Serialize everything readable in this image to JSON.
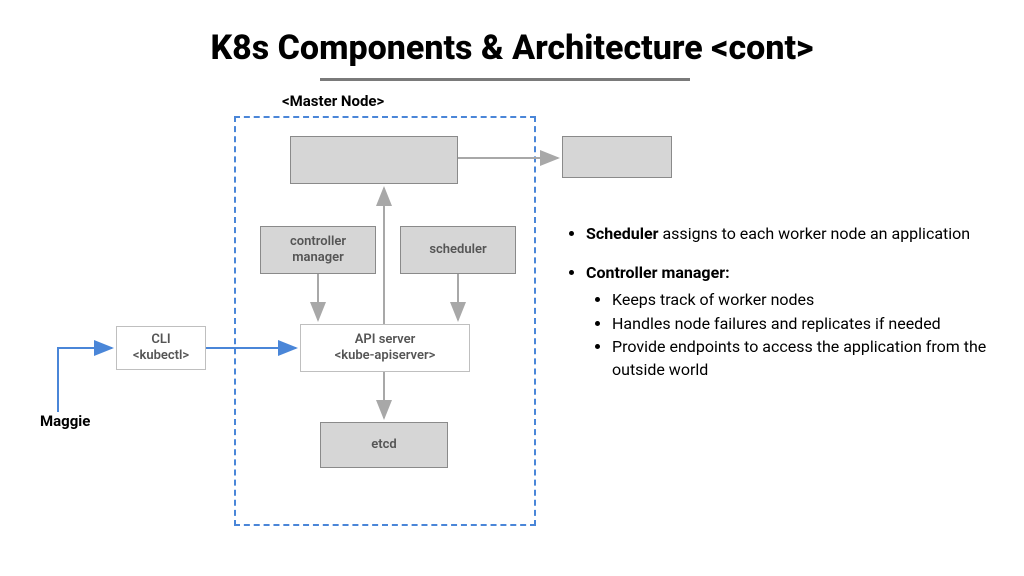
{
  "title": "K8s Components & Architecture <cont>",
  "master_label": "<Master Node>",
  "maggie": "Maggie",
  "boxes": {
    "top_blank": "",
    "right_blank": "",
    "controller_manager": "controller\nmanager",
    "scheduler": "scheduler",
    "api_server": "API server\n<kube-apiserver>",
    "etcd": "etcd",
    "cli": "CLI\n<kubectl>"
  },
  "bullets": {
    "scheduler_bold": "Scheduler",
    "scheduler_text": " assigns to each worker node an application",
    "cm_bold": "Controller manager:",
    "cm_items": [
      " Keeps track of worker nodes",
      "Handles node failures and replicates if needed",
      "Provide endpoints to access the application from the outside world"
    ]
  }
}
